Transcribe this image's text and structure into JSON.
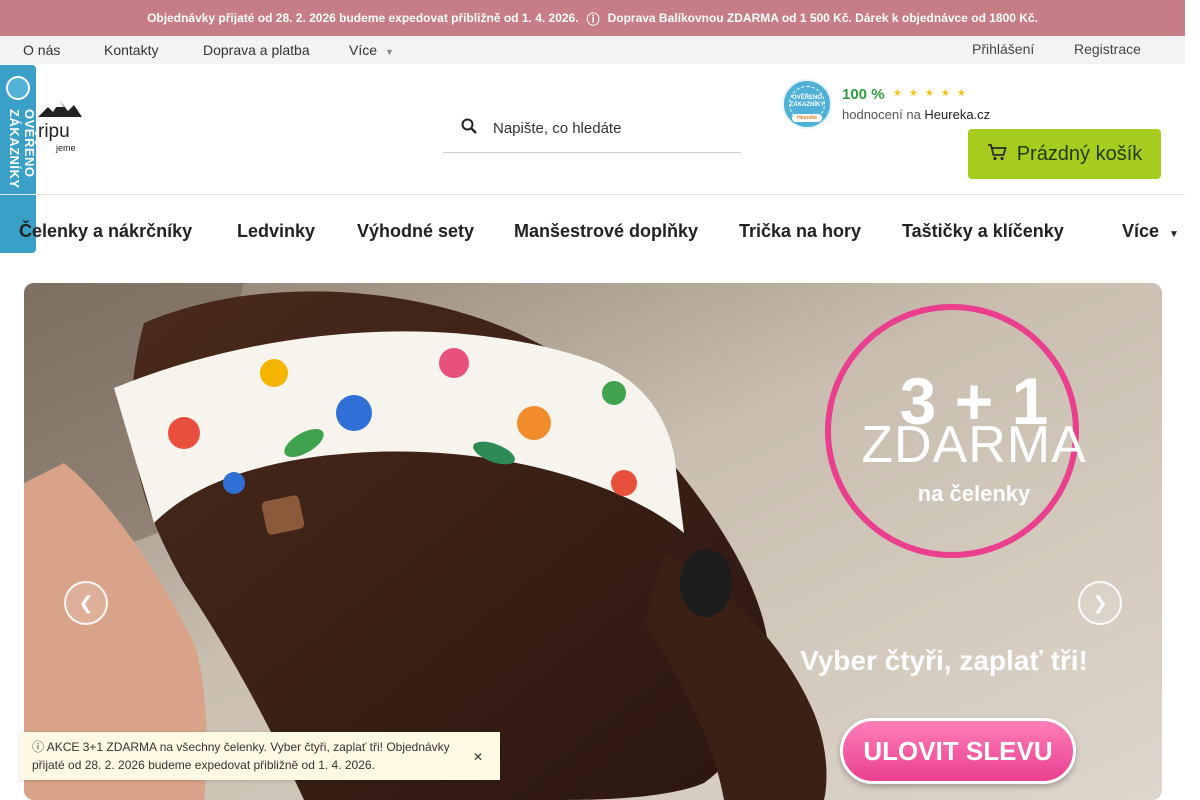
{
  "topbar": {
    "order_notice": "Objednávky přijaté od 28. 2. 2026 budeme expedovat přibližně od 1. 4. 2026.",
    "shipping_notice": "Doprava Balíkovnou ZDARMA od 1 500 Kč. Dárek k objednávce od 1800 Kč.",
    "bg_color": "#c77d85"
  },
  "subnav": {
    "about": "O nás",
    "contacts": "Kontakty",
    "shipping": "Doprava a platba",
    "more": "Více"
  },
  "account": {
    "login": "Přihlášení",
    "register": "Registrace"
  },
  "side_badge": {
    "text": "OVĚŘENO ZÁKAZNÍKY"
  },
  "search": {
    "placeholder": "Napište, co hledáte",
    "icon": "search-icon"
  },
  "heureka": {
    "badge_text": "OVĚŘENO ZÁKAZNÍKY",
    "badge_brand": "Heureka",
    "rating": "100 %",
    "stars": 5,
    "rating_prefix": "hodnocení na",
    "rating_site": "Heureka.cz"
  },
  "cart": {
    "label": "Prázdný košík",
    "icon": "cart-icon",
    "color": "#a6cc1e"
  },
  "categories": {
    "c1": "Čelenky a nákrčníky",
    "c2": "Ledvinky",
    "c3": "Výhodné sety",
    "c4": "Manšestrové doplňky",
    "c5": "Trička na hory",
    "c6": "Taštičky a klíčenky",
    "more": "Více"
  },
  "banner": {
    "headline": "3 + 1",
    "free": "ZDARMA",
    "sub": "na čelenky",
    "tagline": "Vyber čtyři, zaplať tři!",
    "cta": "ULOVIT SLEVU",
    "accent_color": "#ea3f8f"
  },
  "toast": {
    "text": "AKCE 3+1 ZDARMA na všechny čelenky. Vyber čtyři, zaplať tři! Objednávky přijaté od 28. 2. 2026 budeme expedovat přibližně od 1. 4. 2026."
  }
}
